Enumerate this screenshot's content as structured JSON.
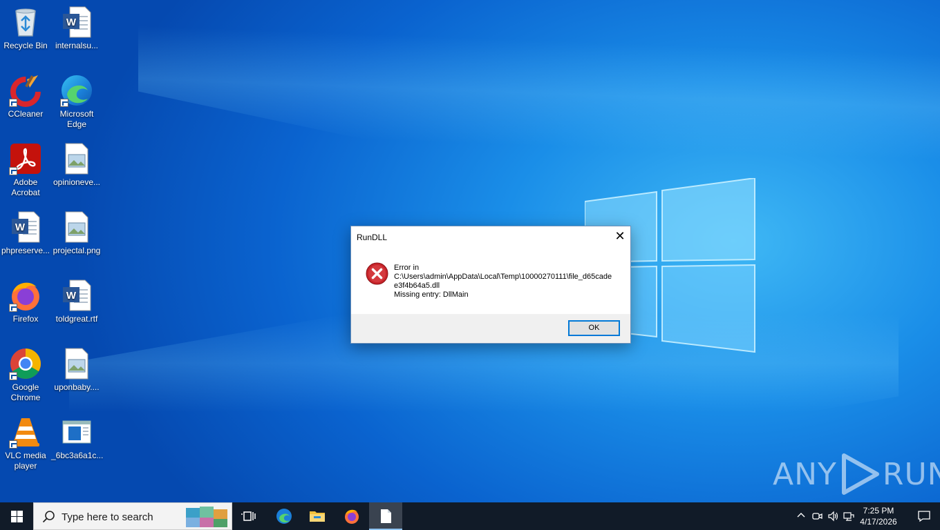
{
  "desktop": {
    "icons": [
      {
        "label": "Recycle Bin",
        "icon": "recycle-bin-icon"
      },
      {
        "label": "internalsu...",
        "icon": "word-document-icon"
      },
      {
        "label": "CCleaner",
        "icon": "ccleaner-icon"
      },
      {
        "label": "Microsoft Edge",
        "icon": "edge-icon"
      },
      {
        "label": "Adobe Acrobat",
        "icon": "acrobat-icon"
      },
      {
        "label": "opinioneve...",
        "icon": "image-file-icon"
      },
      {
        "label": "phpreserve...",
        "icon": "word-document-icon"
      },
      {
        "label": "projectal.png",
        "icon": "image-file-icon"
      },
      {
        "label": "Firefox",
        "icon": "firefox-icon"
      },
      {
        "label": "toldgreat.rtf",
        "icon": "word-document-icon"
      },
      {
        "label": "Google Chrome",
        "icon": "chrome-icon"
      },
      {
        "label": "uponbaby....",
        "icon": "image-file-icon"
      },
      {
        "label": "VLC media player",
        "icon": "vlc-icon"
      },
      {
        "label": "_6bc3a6a1c...",
        "icon": "blue-document-icon"
      }
    ],
    "watermark_left": "ANY",
    "watermark_right": "RUN"
  },
  "dialog": {
    "title": "RunDLL",
    "close_glyph": "✕",
    "message_line1": "Error in",
    "message_path": "C:\\Users\\admin\\AppData\\Local\\Temp\\10000270111\\file_d65cadee3f4b64a5.dll",
    "message_line3": "Missing entry: DllMain",
    "ok_label": "OK"
  },
  "taskbar": {
    "search_placeholder": "Type here to search",
    "time": "7:25 PM",
    "date": "4/17/2026",
    "colors": {
      "bar": "#111b28",
      "accent": "#0078d7"
    }
  }
}
